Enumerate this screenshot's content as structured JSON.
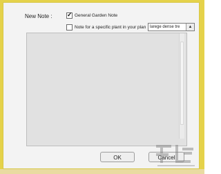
{
  "dialog": {
    "new_note_label": "New Note :",
    "general_note": {
      "label": "General Garden Note",
      "checked": true
    },
    "plant_note": {
      "label": "Note  for a specific plant in your plan",
      "checked": false
    },
    "plant_select": {
      "value": "larege dense tre"
    },
    "note_text": "",
    "buttons": {
      "ok": "OK",
      "cancel": "Cancel"
    }
  },
  "icons": {
    "check": "check-icon",
    "dropdown": "dropdown-arrow-icon"
  },
  "colors": {
    "frame": "#e5d24a",
    "dialog_bg": "#f3f3f3",
    "note_bg": "#e1e1e1"
  }
}
